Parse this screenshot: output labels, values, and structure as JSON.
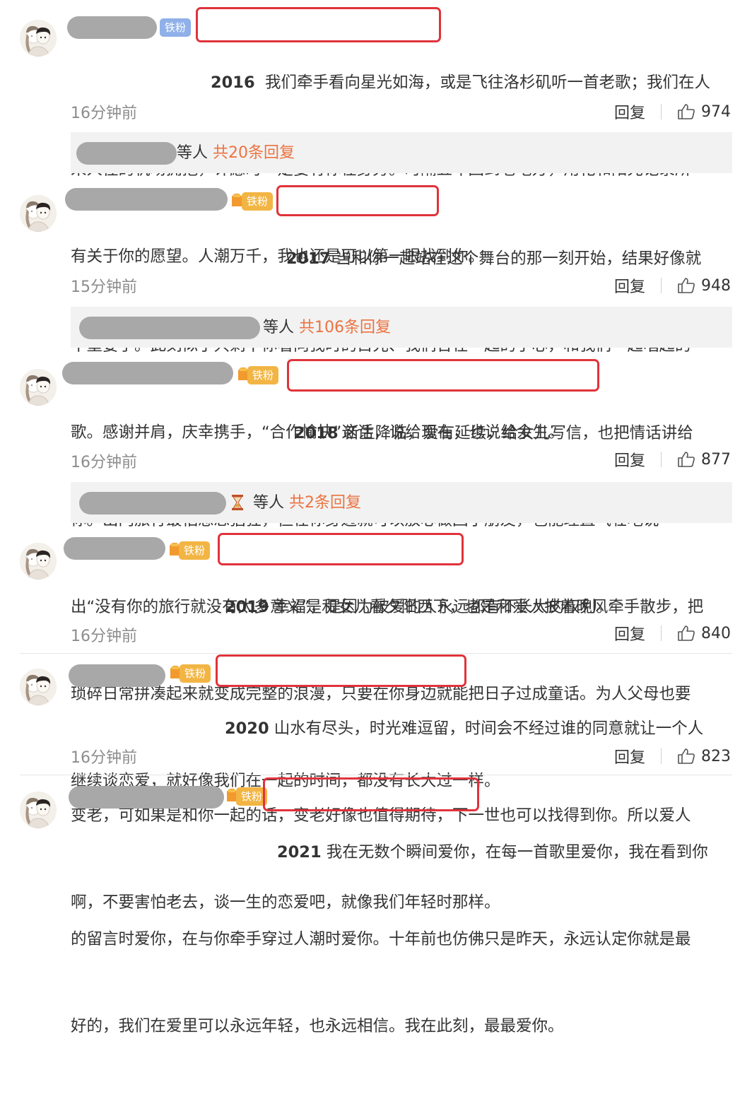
{
  "comments": [
    {
      "badge": "铁粉",
      "year": "2016",
      "lines": [
        "我们牵手看向星光如海，",
        "或是飞往洛杉矶听一首老歌；我们在人",
        "来人往的机场拥抱，许愿时一定要有你在身旁。时隔五年回到老地方，用花和阳光记录所",
        "有关于你的愿望。人潮万千，我也还是可以第一眼找到你。"
      ],
      "time": "16分钟前",
      "reply_label": "回复",
      "likes": "974",
      "thread": {
        "suffix": "等人",
        "count": "共20条回复"
      }
    },
    {
      "badge": "铁粉",
      "level": "5",
      "year": "2017",
      "lines": [
        "当和你一起站",
        "在这个舞台的那一刻开始，结果好像就",
        "不重要了。此刻似乎只剩下你看向我时的目光、我们合在一起的手心，和我们一起唱起的",
        "歌。感谢并肩，庆幸携手，“合作愉快”这话，说给现在，也说给余生。"
      ],
      "time": "15分钟前",
      "reply_label": "回复",
      "likes": "948",
      "thread": {
        "suffix": "等人",
        "count": "共106条回复"
      }
    },
    {
      "badge": "铁粉",
      "level": "5",
      "year": "2018",
      "lines": [
        "新生降临，爱有延续，给女儿写信，",
        "也把情话讲给",
        "你。出门旅行最怕想念猖狂，但在你身边就可以放心做回小朋友，也能理直气壮地说",
        "出“没有你的旅行就没有太多意义”，是因为被爱的人永远都有不长大的权利。"
      ],
      "time": "16分钟前",
      "reply_label": "回复",
      "likes": "877",
      "thread": {
        "suffix": "等人",
        "count": "共2条回复"
      }
    },
    {
      "badge": "铁粉",
      "level": "5",
      "year": "2019",
      "lines": [
        "幸福是和女儿看夕阳西下，",
        "也是和爱人披着晚风牵手散步，把",
        "琐碎日常拼凑起来就变成完整的浪漫，只要在你身边就能把日子过成童话。为人父母也要",
        "继续谈恋爱，就好像我们在一起的时间，都没有长大过一样。"
      ],
      "time": "16分钟前",
      "reply_label": "回复",
      "likes": "840"
    },
    {
      "badge": "铁粉",
      "level": "1",
      "year": "2020",
      "lines": [
        "山水有尽头，时光难逗留，",
        "时间会不经过谁的同意就让一个人",
        "变老，可如果是和你一起的话，变老好像也值得期待，下一世也可以找得到你。所以爱人",
        "啊，不要害怕老去，谈一生的恋爱吧，就像我们年轻时那样。"
      ],
      "time": "16分钟前",
      "reply_label": "回复",
      "likes": "823"
    },
    {
      "badge": "铁粉",
      "level": "6",
      "year": "2021",
      "lines": [
        "我在无数个瞬间爱你，",
        "在每一首歌里爱你，我在看到你",
        "的留言时爱你，在与你牵手穿过人潮时爱你。十年前也仿佛只是昨天，永远认定你就是最",
        "好的，我们在爱里可以永远年轻，也永远相信。我在此刻，最最爱你。"
      ]
    }
  ],
  "colors": {
    "highlight": "#e0333b",
    "reply_count": "#eb7340",
    "badge_gold": "#f2b544",
    "badge_blue": "#8fb0e8"
  }
}
